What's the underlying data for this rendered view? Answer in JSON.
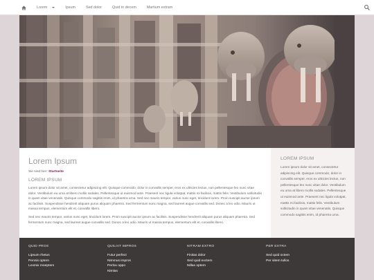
{
  "nav": {
    "items": [
      {
        "label": "Lorem",
        "has_caret": true
      },
      {
        "label": "Ipsum",
        "has_caret": false
      },
      {
        "label": "Sed dolor",
        "has_caret": false
      },
      {
        "label": "Quid in decem",
        "has_caret": false
      },
      {
        "label": "Martium extram",
        "has_caret": false
      }
    ],
    "home_icon": "home-icon",
    "search_icon": "search-icon"
  },
  "main": {
    "title": "Lorem Ipsum",
    "breadcrumb_prefix": "Sie sind hier: ",
    "breadcrumb_link": "Startseite",
    "heading": "LOREM IPSUM",
    "paragraphs": [
      "Lorem ipsum dolor sit amet, consectetur adipiscing elit. Quisque commodo, dolor in convallis semper, eros ex ultricies lectus, non pellentesque leo nunc vitae dolor. Vestibulum eu urna at libero mollis sodales. Pellentesque ut euismod ante. Praesent nec ligula volutpat, mattis mi facilisis, mattis felis. Vestibulum sollicitudin in quam vitae venenatis. Quisque commodo sagittis enim, id pharetra urna. Sed nec mauris tempor, varius nunc eget, tincidunt lorem. Proin suscipit auctor ipsum ac facilisis. Suspendisse hendrerit aliquam purus aliquam pharetra. Sed fermentum nunc magna, sed laoreet augue convallis sed. Donec a leo odio. Mauris ut massa tempus, elementum elit et, convallis libero.",
      "Sed nec mauris tempor, varius nunc eget, tincidunt lorem. Proin suscipit auctor ipsum ac facilisis. Suspendisse hendrerit aliquam purus aliquam pharetra. Sed fermentum nunc magna, sed laoreet augue convallis sed. Donec a leo odio. Mauris ut massa tempus, elementum elit et, convallis libero."
    ]
  },
  "sidebar": {
    "heading": "LOREM IPSUM",
    "text": "Lorem ipsum dolor sit amet, consectetur adipiscing elit. Quisque commodo, dolor in convallis semper, eros ex ultricies lectus, non pellentesque leo nunc vitae dolor. Vestibulum eu urna at libero mollis sodales. Pellentesque ut euismod ante. Praesent nec ligula volutpat, mattis mi facilisis, mattis felis. Vestibulum sollicitudin in quam vitae venenatis. Quisque commodo sagittis enim, id pharetra urna."
  },
  "footer": {
    "columns": [
      {
        "title": "QUID PROS",
        "links": [
          "Lipsum rhetus",
          "Pennis optem",
          "Lexmix moeptem"
        ]
      },
      {
        "title": "QUILIAT IMPROS",
        "links": [
          "Futur perfect",
          "Nimmus impros",
          "Perlox oppo",
          "Nimlas"
        ]
      },
      {
        "title": "NITRAM EXTRO",
        "links": [
          "Finitas dolor",
          "Sed quid exctem",
          "Nillas optem"
        ]
      },
      {
        "title": "PER EXTRA",
        "links": [
          "Sed quid octem",
          "Per sitem tullos"
        ]
      }
    ]
  },
  "colors": {
    "page_background": "#ddd5d7",
    "footer_background": "#3d3938",
    "sidebar_background": "#f6f1f1",
    "breadcrumb_link": "#7a1d55"
  }
}
